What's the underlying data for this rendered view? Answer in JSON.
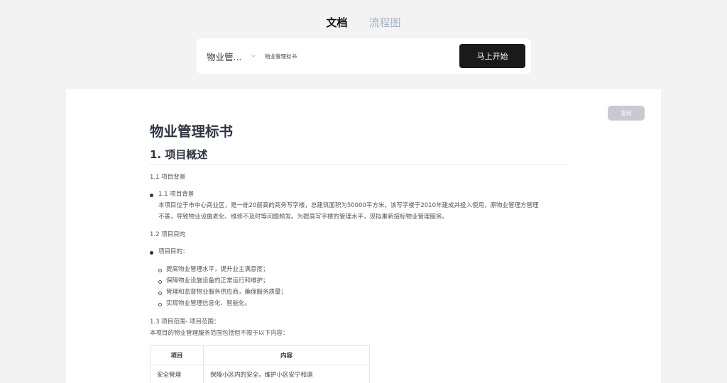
{
  "tabs": [
    {
      "label": "文档",
      "active": true
    },
    {
      "label": "流程图",
      "active": false
    }
  ],
  "input_bar": {
    "select_value": "物业管...",
    "topic_value": "物业管理标书",
    "start_label": "马上开始"
  },
  "document": {
    "copy_label": "复制",
    "title": "物业管理标书",
    "section1_heading": "1. 项目概述",
    "s1_1_label": "1.1 项目背景",
    "s1_1_bullet_title": "1.1 项目背景",
    "s1_1_line1": "本项目位于市中心商业区，是一栋20层高的商务写字楼，总建筑面积为50000平方米。该写字楼于2010年建成并投入使用，原物业管理方管理",
    "s1_1_line2": "不善，导致物业设施老化、维修不及时等问题频发。为提高写字楼的管理水平，现拟重新招标物业管理服务。",
    "s1_2_label": "1.2 项目目的",
    "s1_2_bullet": "项目目的：",
    "goals": [
      "提高物业管理水平，提升业主满意度；",
      "保障物业设施设备的正常运行和维护；",
      "管理和监督物业服务供应商，确保服务质量；",
      "实现物业管理信息化、智能化。"
    ],
    "s1_3_label": "1.3 项目范围- 项目范围：",
    "s1_3_text": "本项目的物业管理服务范围包括但不限于以下内容：",
    "table": {
      "headers": [
        "项目",
        "内容"
      ],
      "rows": [
        [
          "安全管理",
          "保障小区内的安全，维护小区安宁和谐"
        ]
      ]
    }
  },
  "colors": {
    "background": "#f3f3f3",
    "start_button": "#1a1a1a",
    "copy_button": "#c9c9cf",
    "inactive_tab": "#a9b1c2"
  },
  "icons": {
    "select_chevron": "chevron-down-icon"
  }
}
